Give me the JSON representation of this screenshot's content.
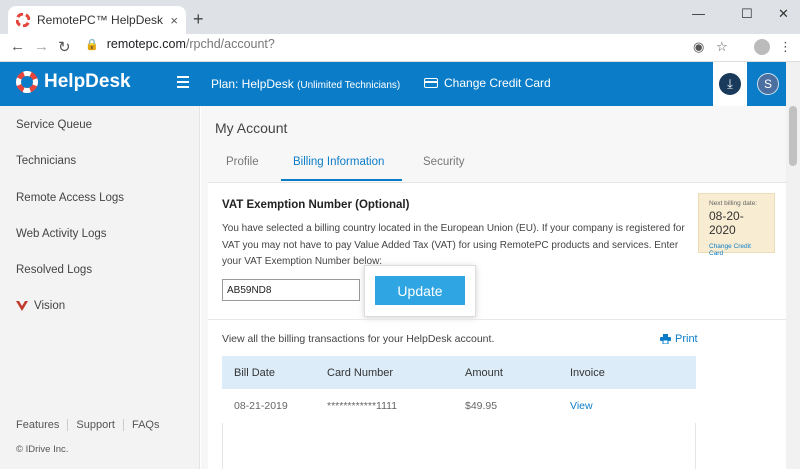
{
  "browser": {
    "tab_title": "RemotePC™ HelpDesk - my acco",
    "tab_close": "×",
    "new_tab": "+",
    "url_domain": "remotepc.com",
    "url_path": "/rpchd/account?",
    "window_controls": [
      "—",
      "☐",
      "✕"
    ]
  },
  "app": {
    "brand": "HelpDesk",
    "plan_label": "Plan: HelpDesk",
    "plan_detail": "(Unlimited Technicians)",
    "change_credit_card": "Change Credit Card",
    "user_initial": "S",
    "brand_color": "#0b7dc8"
  },
  "sidebar": {
    "items": [
      {
        "label": "Service Queue"
      },
      {
        "label": "Technicians"
      },
      {
        "label": "Remote Access Logs"
      },
      {
        "label": "Web Activity Logs"
      },
      {
        "label": "Resolved Logs"
      },
      {
        "label": "Vision"
      }
    ],
    "footer_links": [
      "Features",
      "Support",
      "FAQs"
    ],
    "copyright": "© IDrive Inc."
  },
  "main": {
    "page_title": "My Account",
    "tabs": [
      {
        "label": "Profile",
        "active": false
      },
      {
        "label": "Billing Information",
        "active": true
      },
      {
        "label": "Security",
        "active": false
      }
    ],
    "vat": {
      "title": "VAT Exemption Number (Optional)",
      "description": "You have selected a billing country located in the European Union (EU). If your company is registered for VAT you may not have to pay Value Added Tax (VAT) for using RemotePC products and services. Enter your VAT Exemption Number below:",
      "input_value": "AB59ND8",
      "update_label": "Update"
    },
    "next_billing": {
      "label": "Next billing date:",
      "date": "08-20-2020",
      "change_link": "Change Credit Card"
    },
    "billing_note": "View all the billing transactions for your HelpDesk account.",
    "print_label": "Print",
    "table": {
      "headers": [
        "Bill Date",
        "Card Number",
        "Amount",
        "Invoice"
      ],
      "rows": [
        {
          "bill_date": "08-21-2019",
          "card_number": "************1111",
          "amount": "$49.95",
          "invoice": "View"
        }
      ]
    }
  }
}
